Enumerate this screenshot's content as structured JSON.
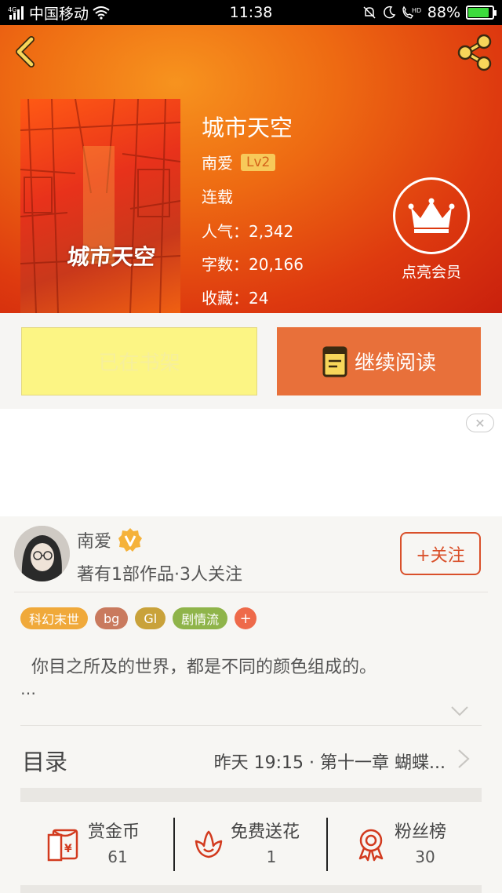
{
  "status_bar": {
    "carrier": "中国移动",
    "network": "4G",
    "time": "11:38",
    "hd": "HD",
    "battery_percent": "88%",
    "battery_level": 0.88
  },
  "book": {
    "title": "城市天空",
    "cover_text": "城市天空",
    "author": "南爱",
    "level": "Lv2",
    "status": "连载",
    "popularity_label": "人气：",
    "popularity": "2,342",
    "words_label": "字数：",
    "words": "20,166",
    "favorites_label": "收藏：",
    "favorites": "24"
  },
  "vip": {
    "label": "点亮会员"
  },
  "actions": {
    "shelf_label": "已在书架",
    "read_label": "继续阅读"
  },
  "ad": {
    "close_symbol": "✕"
  },
  "author_card": {
    "name": "南爱",
    "meta": "著有1部作品·3人关注",
    "follow_label": "+关注"
  },
  "tags": [
    {
      "label": "科幻末世",
      "color": "#f0a93a"
    },
    {
      "label": "bg",
      "color": "#c97a5e"
    },
    {
      "label": "Gl",
      "color": "#c9a23a"
    },
    {
      "label": "剧情流",
      "color": "#8fb44a"
    },
    {
      "label": "+",
      "color": "#ee6a4a"
    }
  ],
  "intro": {
    "text": "你目之所及的世界，都是不同的颜色组成的。",
    "more": "…"
  },
  "catalog": {
    "title": "目录",
    "latest": "昨天 19:15 · 第十一章 蝴蝶..."
  },
  "stats": {
    "reward_label": "赏金币",
    "reward_value": "61",
    "flower_label": "免费送花",
    "flower_value": "1",
    "fans_label": "粉丝榜",
    "fans_value": "30"
  },
  "colors": {
    "accent": "#e8703a",
    "follow": "#d9502a",
    "stat_icon": "#d23a1e"
  },
  "icons": [
    "back-icon",
    "share-icon",
    "crown-icon",
    "book-icon",
    "verified-icon",
    "chevron-down-icon",
    "chevron-right-icon",
    "red-envelope-icon",
    "flower-icon",
    "medal-icon"
  ]
}
